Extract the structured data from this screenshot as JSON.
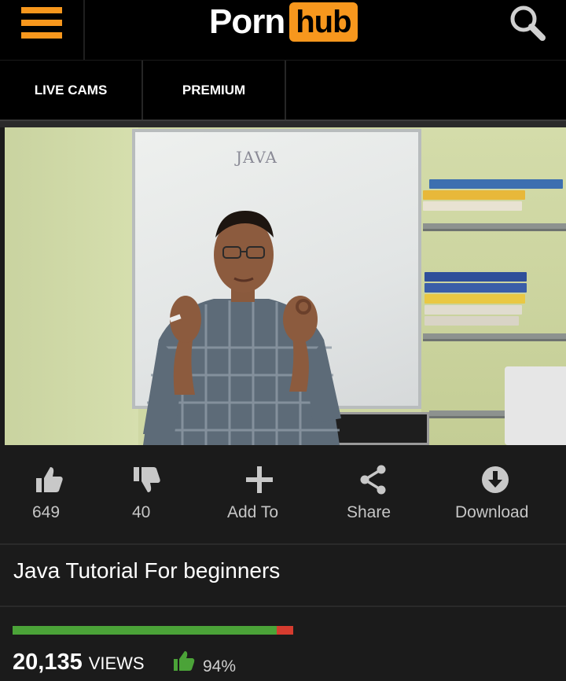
{
  "header": {
    "logo_part1": "Porn",
    "logo_part2": "hub",
    "icons": {
      "menu": "hamburger-menu-icon",
      "search": "search-icon"
    },
    "brand_color": "#f7971d"
  },
  "nav": {
    "items": [
      {
        "label": "LIVE CAMS"
      },
      {
        "label": "PREMIUM"
      }
    ]
  },
  "video": {
    "board_text": "JAVA"
  },
  "actions": {
    "likes": "649",
    "dislikes": "40",
    "add_to": "Add To",
    "share": "Share",
    "download": "Download"
  },
  "video_title": "Java Tutorial For beginners",
  "stats": {
    "views_count": "20,135",
    "views_label": "VIEWS",
    "rating_percent": "94%",
    "rating_fraction": 0.94,
    "colors": {
      "good": "#4ba338",
      "bad": "#d63c2f"
    }
  }
}
